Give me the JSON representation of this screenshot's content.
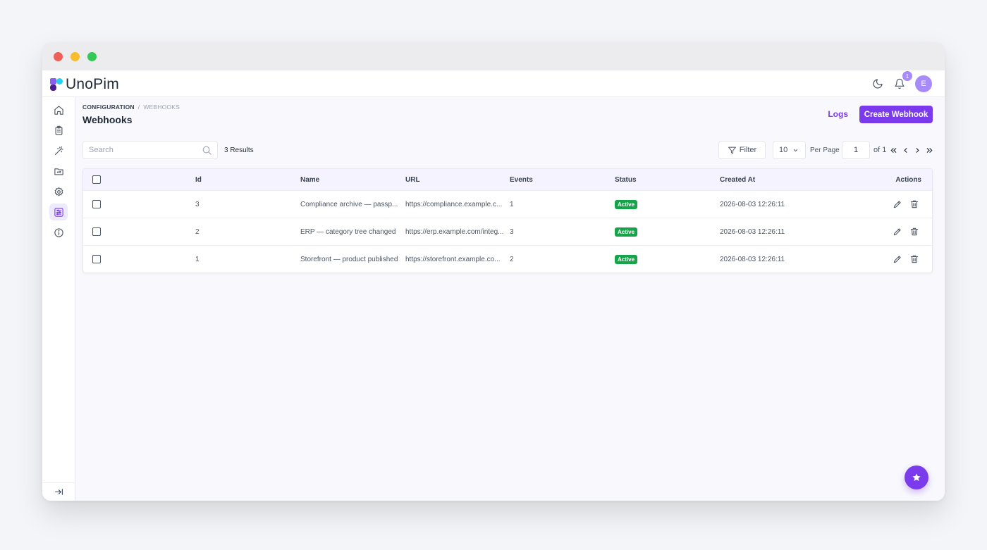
{
  "app": {
    "logo_text": "UnoPim",
    "notifications_count": "1",
    "avatar_initial": "E",
    "colors": {
      "accent": "#7c3aed",
      "active_badge": "#16a34a",
      "avatar": "#a78bfa"
    }
  },
  "sidebar": {
    "items": [
      {
        "icon": "home-icon"
      },
      {
        "icon": "clipboard-icon"
      },
      {
        "icon": "magic-wand-icon"
      },
      {
        "icon": "folder-sync-icon"
      },
      {
        "icon": "gear-icon"
      },
      {
        "icon": "sliders-icon",
        "active": true
      },
      {
        "icon": "info-icon"
      }
    ]
  },
  "header": {
    "breadcrumb": [
      "CONFIGURATION",
      "WEBHOOKS"
    ],
    "breadcrumb_sep": "/",
    "title": "Webhooks",
    "logs_label": "Logs",
    "create_label": "Create Webhook"
  },
  "toolbar": {
    "search_placeholder": "Search",
    "results": "3 Results",
    "filter_label": "Filter",
    "per_page_value": "10",
    "per_page_label": "Per Page",
    "page_value": "1",
    "of_label": "of 1"
  },
  "table": {
    "columns": [
      "Id",
      "Name",
      "URL",
      "Events",
      "Status",
      "Created At",
      "Actions"
    ],
    "rows": [
      {
        "id": "3",
        "name": "Compliance archive — passp...",
        "url": "https://compliance.example.c...",
        "events": "1",
        "status": "Active",
        "created_at": "2026-08-03 12:26:11"
      },
      {
        "id": "2",
        "name": "ERP — category tree changed",
        "url": "https://erp.example.com/integ...",
        "events": "3",
        "status": "Active",
        "created_at": "2026-08-03 12:26:11"
      },
      {
        "id": "1",
        "name": "Storefront — product published",
        "url": "https://storefront.example.co...",
        "events": "2",
        "status": "Active",
        "created_at": "2026-08-03 12:26:11"
      }
    ]
  }
}
